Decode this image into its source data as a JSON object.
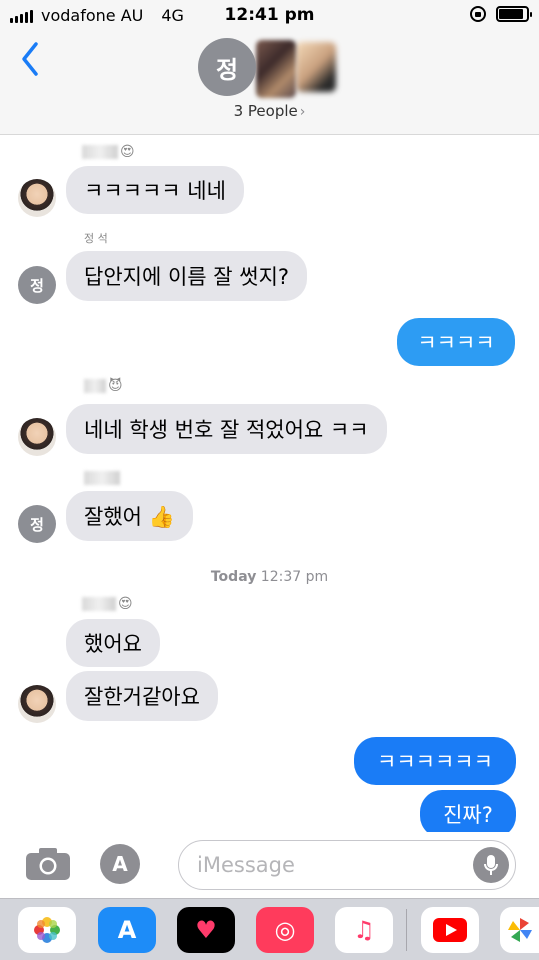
{
  "status_bar": {
    "carrier": "vodafone AU",
    "network": "4G",
    "time": "12:41 pm",
    "battery_level": 0.9
  },
  "header": {
    "avatar_initial": "정",
    "people_label": "3 People",
    "back_icon": "chevron-left-icon"
  },
  "messages": [
    {
      "side": "in",
      "sender_visible": "",
      "text": "ㅋㅋㅋㅋㅋ 네네",
      "avatar": "photo"
    },
    {
      "side": "in",
      "sender_visible": "정  석",
      "text": "답안지에 이름 잘 썻지?",
      "avatar": "정"
    },
    {
      "side": "out",
      "text": "ㅋㅋㅋㅋ"
    },
    {
      "side": "in",
      "sender_visible": "",
      "text": "네네 학생 번호 잘 적었어요 ㅋㅋ",
      "avatar": "photo"
    },
    {
      "side": "in",
      "sender_visible": "",
      "text": "잘했어 👍",
      "avatar": "정"
    },
    {
      "side": "in",
      "sender_visible": "",
      "text": "했어요",
      "avatar": ""
    },
    {
      "side": "in",
      "sender_visible": "",
      "text": "잘한거같아요",
      "avatar": "photo"
    },
    {
      "side": "out",
      "text": "ㅋㅋㅋㅋㅋㅋ"
    },
    {
      "side": "out",
      "text": "진짜?"
    }
  ],
  "timestamp": {
    "day": "Today",
    "time": "12:37 pm"
  },
  "input": {
    "placeholder": "iMessage"
  },
  "drawer_apps": [
    "photos-app-icon",
    "app-store-icon",
    "heart-app-icon",
    "search-globe-app-icon",
    "music-app-icon",
    "youtube-app-icon",
    "pinwheel-app-icon"
  ],
  "colors": {
    "incoming": "#e5e5ea",
    "outgoing": "#1a7cf6",
    "accent": "#1a7cf6"
  }
}
